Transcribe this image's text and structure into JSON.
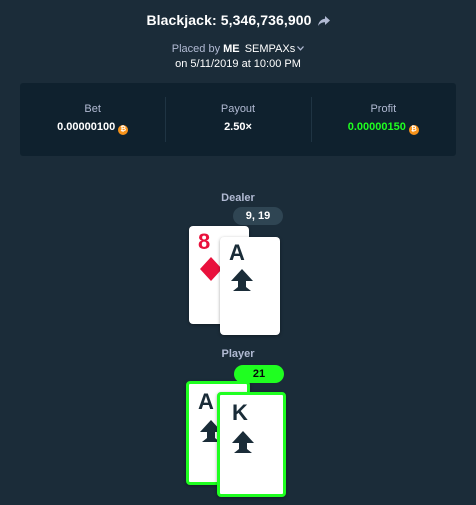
{
  "header": {
    "title": "Blackjack: 5,346,736,900",
    "placed_by_prefix": "Placed by",
    "placed_by_me": "ME",
    "placed_by_user": "SEMPAXs",
    "date_text": "on 5/11/2019 at 10:00 PM"
  },
  "stats": {
    "bet_label": "Bet",
    "bet_value": "0.00000100",
    "payout_label": "Payout",
    "payout_value": "2.50×",
    "profit_label": "Profit",
    "profit_value": "0.00000150",
    "currency_icon": "bitcoin-icon",
    "profit_color": "#1fff20"
  },
  "dealer": {
    "label": "Dealer",
    "score": "9, 19",
    "cards": [
      {
        "rank": "8",
        "suit": "diamond",
        "color": "#e9113c"
      },
      {
        "rank": "A",
        "suit": "spade",
        "color": "#1a2c38"
      }
    ]
  },
  "player": {
    "label": "Player",
    "score": "21",
    "outcome_color": "#1fff20",
    "cards": [
      {
        "rank": "A",
        "suit": "spade",
        "color": "#1a2c38"
      },
      {
        "rank": "K",
        "suit": "spade",
        "color": "#1a2c38"
      }
    ]
  }
}
